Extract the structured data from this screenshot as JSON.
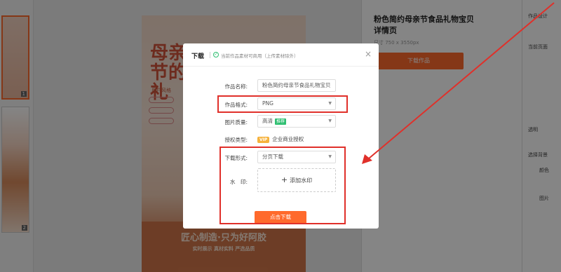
{
  "background": {
    "poster_title": "母亲节的礼",
    "poster_subtitle": "用户风格",
    "band_line1": "匠心制造·只为好阿胶",
    "band_line2": "实时展示 真材实料 严选品质",
    "product_title": "粉色简约母亲节食品礼物宝贝详情页",
    "product_meta": "尺寸 750 x 3550px",
    "download_label": "下载作品",
    "side_labels": [
      "作品设计",
      "当前页面",
      "透明",
      "选择背景",
      "颜色",
      "图片"
    ],
    "thumb_numbers": [
      "1",
      "2"
    ]
  },
  "dialog": {
    "title": "下载",
    "notice": "当前作品素材可商用（上传素材除外）",
    "close": "×",
    "name_label": "作品名称:",
    "name_value": "粉色简约母亲节食品礼物宝贝",
    "format_label": "作品格式:",
    "format_value": "PNG",
    "quality_label": "图片质量:",
    "quality_value": "高清",
    "quality_tag": "推荐",
    "license_label": "授权类型:",
    "license_badge": "VIP",
    "license_value": "企业商业授权",
    "mode_label": "下载形式:",
    "mode_value": "分页下载",
    "watermark_label": "水　印:",
    "watermark_action": "添加水印",
    "download_button": "点击下载"
  },
  "colors": {
    "accent": "#ff6a2c",
    "highlight": "#e0302a",
    "ok_green": "#2fbf71"
  }
}
